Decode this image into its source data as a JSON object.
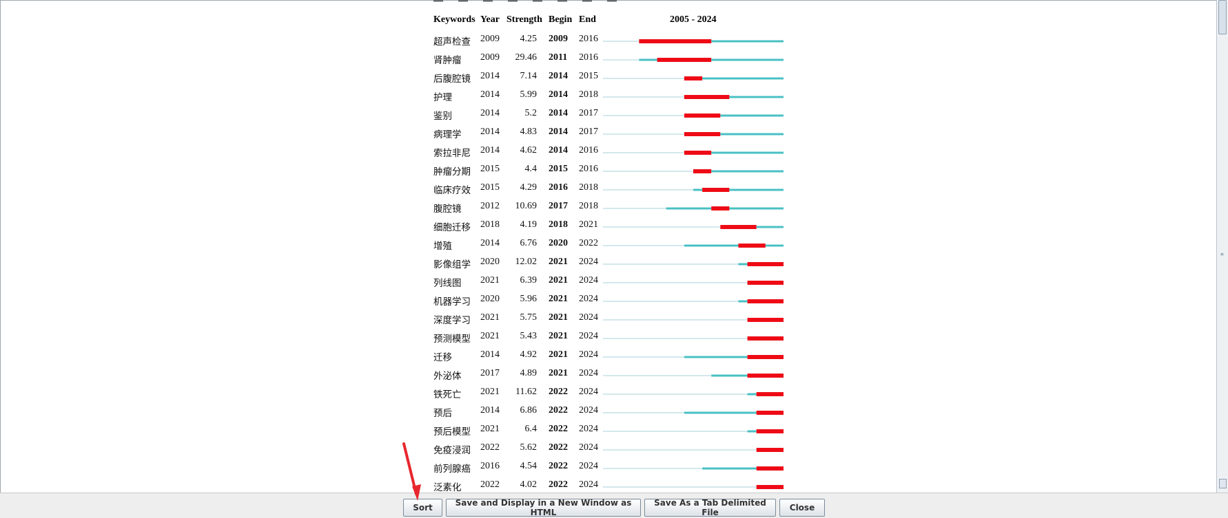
{
  "table": {
    "headers": {
      "keywords": "Keywords",
      "year": "Year",
      "strength": "Strength",
      "begin": "Begin",
      "end": "End",
      "range": "2005 - 2024"
    },
    "range_start": 2005,
    "range_end": 2024,
    "rows": [
      {
        "keyword": "超声检查",
        "year": "2009",
        "strength": "4.25",
        "begin": "2009",
        "end": "2016"
      },
      {
        "keyword": "肾肿瘤",
        "year": "2009",
        "strength": "29.46",
        "begin": "2011",
        "end": "2016"
      },
      {
        "keyword": "后腹腔镜",
        "year": "2014",
        "strength": "7.14",
        "begin": "2014",
        "end": "2015"
      },
      {
        "keyword": "护理",
        "year": "2014",
        "strength": "5.99",
        "begin": "2014",
        "end": "2018"
      },
      {
        "keyword": "鉴别",
        "year": "2014",
        "strength": "5.2",
        "begin": "2014",
        "end": "2017"
      },
      {
        "keyword": "病理学",
        "year": "2014",
        "strength": "4.83",
        "begin": "2014",
        "end": "2017"
      },
      {
        "keyword": "索拉非尼",
        "year": "2014",
        "strength": "4.62",
        "begin": "2014",
        "end": "2016"
      },
      {
        "keyword": "肿瘤分期",
        "year": "2015",
        "strength": "4.4",
        "begin": "2015",
        "end": "2016"
      },
      {
        "keyword": "临床疗效",
        "year": "2015",
        "strength": "4.29",
        "begin": "2016",
        "end": "2018"
      },
      {
        "keyword": "腹腔镜",
        "year": "2012",
        "strength": "10.69",
        "begin": "2017",
        "end": "2018"
      },
      {
        "keyword": "细胞迁移",
        "year": "2018",
        "strength": "4.19",
        "begin": "2018",
        "end": "2021"
      },
      {
        "keyword": "增殖",
        "year": "2014",
        "strength": "6.76",
        "begin": "2020",
        "end": "2022"
      },
      {
        "keyword": "影像组学",
        "year": "2020",
        "strength": "12.02",
        "begin": "2021",
        "end": "2024"
      },
      {
        "keyword": "列线图",
        "year": "2021",
        "strength": "6.39",
        "begin": "2021",
        "end": "2024"
      },
      {
        "keyword": "机器学习",
        "year": "2020",
        "strength": "5.96",
        "begin": "2021",
        "end": "2024"
      },
      {
        "keyword": "深度学习",
        "year": "2021",
        "strength": "5.75",
        "begin": "2021",
        "end": "2024"
      },
      {
        "keyword": "预测模型",
        "year": "2021",
        "strength": "5.43",
        "begin": "2021",
        "end": "2024"
      },
      {
        "keyword": "迁移",
        "year": "2014",
        "strength": "4.92",
        "begin": "2021",
        "end": "2024"
      },
      {
        "keyword": "外泌体",
        "year": "2017",
        "strength": "4.89",
        "begin": "2021",
        "end": "2024"
      },
      {
        "keyword": "铁死亡",
        "year": "2021",
        "strength": "11.62",
        "begin": "2022",
        "end": "2024"
      },
      {
        "keyword": "预后",
        "year": "2014",
        "strength": "6.86",
        "begin": "2022",
        "end": "2024"
      },
      {
        "keyword": "预后模型",
        "year": "2021",
        "strength": "6.4",
        "begin": "2022",
        "end": "2024"
      },
      {
        "keyword": "免疫浸润",
        "year": "2022",
        "strength": "5.62",
        "begin": "2022",
        "end": "2024"
      },
      {
        "keyword": "前列腺癌",
        "year": "2016",
        "strength": "4.54",
        "begin": "2022",
        "end": "2024"
      },
      {
        "keyword": "泛素化",
        "year": "2022",
        "strength": "4.02",
        "begin": "2022",
        "end": "2024"
      }
    ]
  },
  "colors": {
    "pre_year": "#d3e8ec",
    "active": "#48c0c4",
    "burst": "#ee0b16",
    "annotation_arrow": "#e8262d"
  },
  "buttons": {
    "sort": "Sort",
    "save_html": "Save and Display in a New Window as HTML",
    "save_tab": "Save As a Tab Delimited File",
    "close": "Close"
  }
}
